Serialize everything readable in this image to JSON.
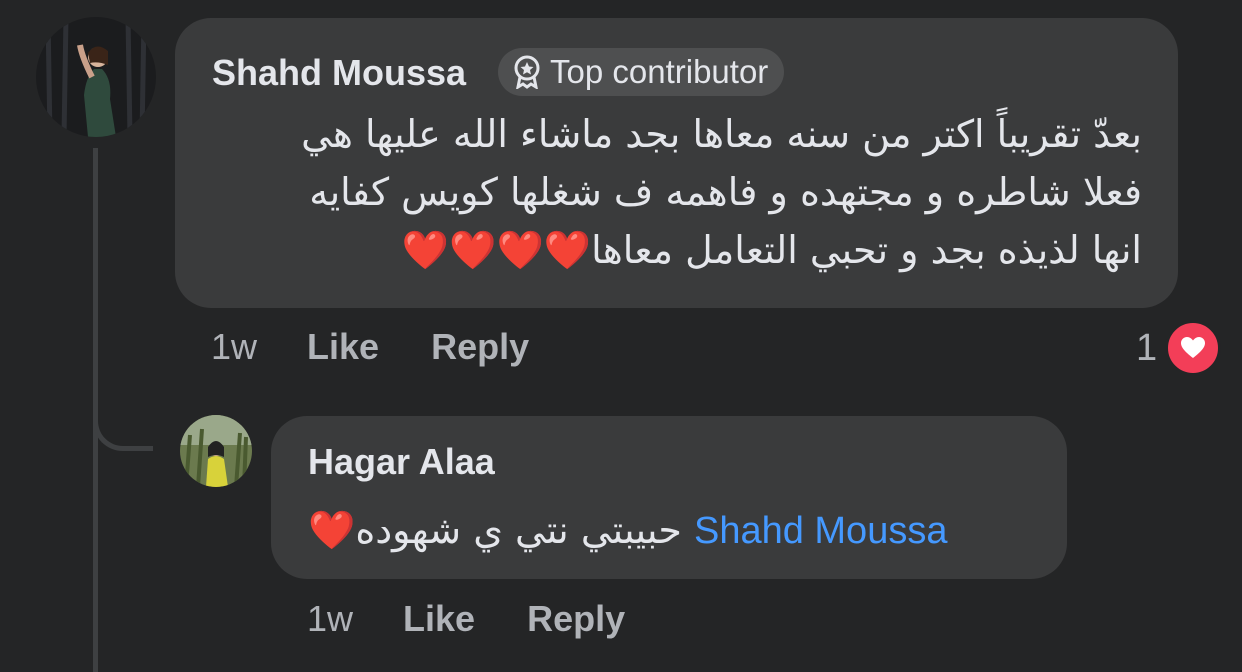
{
  "colors": {
    "background": "#242526",
    "bubble": "#3a3b3c",
    "text": "#e4e6eb",
    "secondary_text": "#b0b3b8",
    "mention": "#4599ff",
    "love_reaction": "#f33e58",
    "heart_emoji": "#e41e3f"
  },
  "comment": {
    "author": "Shahd Moussa",
    "badge": {
      "icon": "top-contributor-badge-icon",
      "label": "Top contributor"
    },
    "lines": [
      "بعدّ تقريباً اكتر من سنه معاها بجد ماشاء الله عليها هي",
      "فعلا شاطره و مجتهده و فاهمه ف شغلها كويس كفايه",
      "انها لذيذه بجد و تحبي التعامل معاها"
    ],
    "hearts": "❤️❤️❤️❤️",
    "time": "1w",
    "like_label": "Like",
    "reply_label": "Reply",
    "reaction_count": "1",
    "reaction_icon": "love-reaction-icon"
  },
  "reply": {
    "author": "Hagar Alaa",
    "mention": "Shahd Moussa",
    "text": "حبيبتي نتي ي شهوده",
    "heart": "❤️",
    "time": "1w",
    "like_label": "Like",
    "reply_label": "Reply"
  }
}
